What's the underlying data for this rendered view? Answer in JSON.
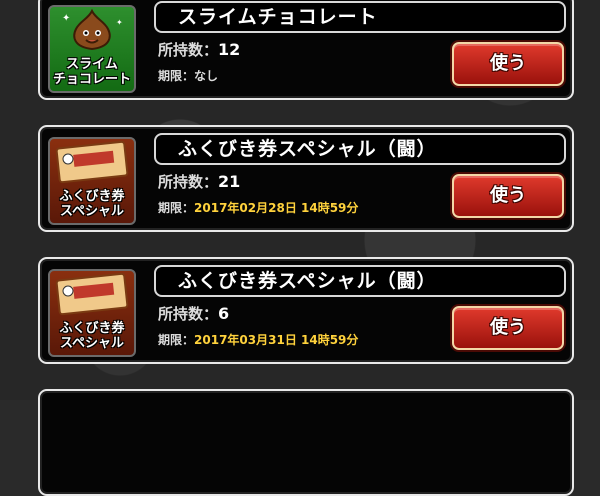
{
  "items": [
    {
      "name": "スライムチョコレート",
      "icon_caption_1": "スライム",
      "icon_caption_2": "チョコレート",
      "icon": "slime-chocolate-icon",
      "qty_label": "所持数：",
      "qty": "12",
      "exp_label": "期限：",
      "exp": "なし",
      "button": "使う"
    },
    {
      "name": "ふくびき券スペシャル（闘）",
      "icon_caption_1": "ふくびき券",
      "icon_caption_2": "スペシャル",
      "icon": "lottery-ticket-icon",
      "qty_label": "所持数：",
      "qty": "21",
      "exp_label": "期限：",
      "exp": "2017年02月28日 14時59分",
      "button": "使う"
    },
    {
      "name": "ふくびき券スペシャル（闘）",
      "icon_caption_1": "ふくびき券",
      "icon_caption_2": "スペシャル",
      "icon": "lottery-ticket-icon",
      "qty_label": "所持数：",
      "qty": "6",
      "exp_label": "期限：",
      "exp": "2017年03月31日 14時59分",
      "button": "使う"
    }
  ],
  "colors": {
    "expiry_date": "#ffd23c",
    "use_button": "#c4251b",
    "card_border": "#e9e9e9"
  }
}
